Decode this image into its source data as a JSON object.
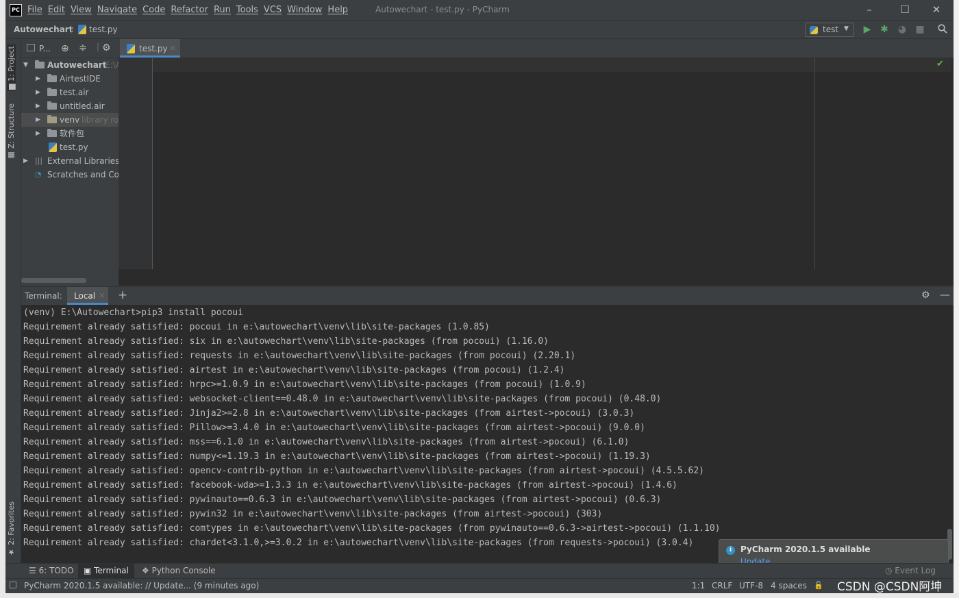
{
  "window": {
    "title": "Autowechart - test.py - PyCharm",
    "logo_text": "PC",
    "minimize": "–",
    "maximize": "☐",
    "close": "✕"
  },
  "menu": [
    "File",
    "Edit",
    "View",
    "Navigate",
    "Code",
    "Refactor",
    "Run",
    "Tools",
    "VCS",
    "Window",
    "Help"
  ],
  "navbar": {
    "project": "Autowechart",
    "separator": "〉",
    "file": "test.py",
    "run_config": "test"
  },
  "left_strip": {
    "project_tab": "1: Project",
    "structure_tab": "Z: Structure",
    "favorites_tab": "2: Favorites"
  },
  "project_panel": {
    "view_label": "P...",
    "root_name": "Autowechart",
    "root_path": "E:\\A",
    "items": [
      {
        "label": "AirtestIDE",
        "hint": ""
      },
      {
        "label": "test.air",
        "hint": ""
      },
      {
        "label": "untitled.air",
        "hint": ""
      },
      {
        "label": "venv",
        "hint": "library ro"
      },
      {
        "label": "软件包",
        "hint": ""
      },
      {
        "label": "test.py",
        "hint": ""
      }
    ],
    "external_libraries": "External Libraries",
    "scratches": "Scratches and Cor"
  },
  "editor": {
    "tab_label": "test.py",
    "tab_close": "×",
    "inspection_icon": "check-icon"
  },
  "terminal": {
    "title": "Terminal:",
    "tab_local": "Local",
    "tab_close": "×",
    "add": "+",
    "lines": [
      "(venv) E:\\Autowechart>pip3 install pocoui",
      "Requirement already satisfied: pocoui in e:\\autowechart\\venv\\lib\\site-packages (1.0.85)",
      "Requirement already satisfied: six in e:\\autowechart\\venv\\lib\\site-packages (from pocoui) (1.16.0)",
      "Requirement already satisfied: requests in e:\\autowechart\\venv\\lib\\site-packages (from pocoui) (2.20.1)",
      "Requirement already satisfied: airtest in e:\\autowechart\\venv\\lib\\site-packages (from pocoui) (1.2.4)",
      "Requirement already satisfied: hrpc>=1.0.9 in e:\\autowechart\\venv\\lib\\site-packages (from pocoui) (1.0.9)",
      "Requirement already satisfied: websocket-client==0.48.0 in e:\\autowechart\\venv\\lib\\site-packages (from pocoui) (0.48.0)",
      "Requirement already satisfied: Jinja2>=2.8 in e:\\autowechart\\venv\\lib\\site-packages (from airtest->pocoui) (3.0.3)",
      "Requirement already satisfied: Pillow>=3.4.0 in e:\\autowechart\\venv\\lib\\site-packages (from airtest->pocoui) (9.0.0)",
      "Requirement already satisfied: mss==6.1.0 in e:\\autowechart\\venv\\lib\\site-packages (from airtest->pocoui) (6.1.0)",
      "Requirement already satisfied: numpy<=1.19.3 in e:\\autowechart\\venv\\lib\\site-packages (from airtest->pocoui) (1.19.3)",
      "Requirement already satisfied: opencv-contrib-python in e:\\autowechart\\venv\\lib\\site-packages (from airtest->pocoui) (4.5.5.62)",
      "Requirement already satisfied: facebook-wda>=1.3.3 in e:\\autowechart\\venv\\lib\\site-packages (from airtest->pocoui) (1.4.6)",
      "Requirement already satisfied: pywinauto==0.6.3 in e:\\autowechart\\venv\\lib\\site-packages (from airtest->pocoui) (0.6.3)",
      "Requirement already satisfied: pywin32 in e:\\autowechart\\venv\\lib\\site-packages (from airtest->pocoui) (303)",
      "Requirement already satisfied: comtypes in e:\\autowechart\\venv\\lib\\site-packages (from pywinauto==0.6.3->airtest->pocoui) (1.1.10)",
      "Requirement already satisfied: chardet<3.1.0,>=3.0.2 in e:\\autowechart\\venv\\lib\\site-packages (from requests->pocoui) (3.0.4)"
    ]
  },
  "notification": {
    "title": "PyCharm 2020.1.5 available",
    "link": "Update..."
  },
  "bottom_tabs": {
    "todo": "6: TODO",
    "terminal": "Terminal",
    "python_console": "Python Console",
    "event_log": "Event Log"
  },
  "statusbar": {
    "message": "PyCharm 2020.1.5 available: // Update... (9 minutes ago)",
    "position": "1:1",
    "line_separator": "CRLF",
    "encoding": "UTF-8",
    "indent": "4 spaces"
  },
  "watermark": "CSDN @CSDN阿坤"
}
